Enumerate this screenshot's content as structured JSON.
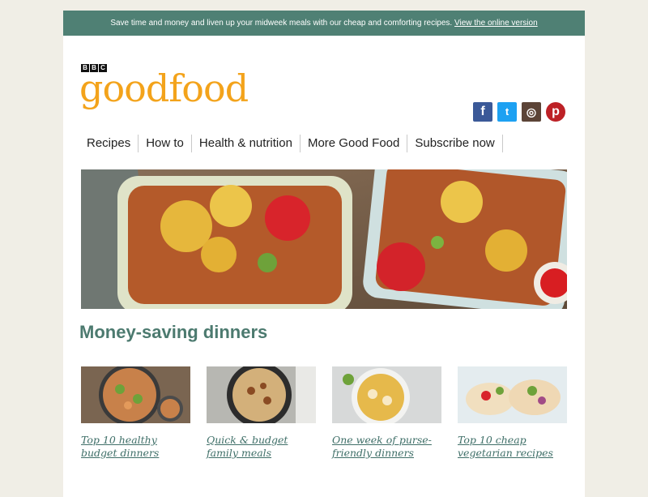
{
  "banner": {
    "text": "Save time and money and liven up your midweek meals with our cheap and comforting recipes.",
    "link": "View the online version"
  },
  "logo": {
    "bbc_letters": [
      "B",
      "B",
      "C"
    ],
    "wordmark": "goodfood"
  },
  "social": [
    {
      "name": "facebook-icon",
      "glyph": "f"
    },
    {
      "name": "twitter-icon",
      "glyph": "t"
    },
    {
      "name": "instagram-icon",
      "glyph": "◎"
    },
    {
      "name": "pinterest-icon",
      "glyph": "p"
    }
  ],
  "nav": [
    "Recipes",
    "How to",
    "Health & nutrition",
    "More Good Food",
    "Subscribe now"
  ],
  "section_title": "Money-saving dinners",
  "cards": [
    {
      "label": "Top 10 healthy budget dinners"
    },
    {
      "label": "Quick & budget family meals"
    },
    {
      "label": "One week of purse-friendly dinners"
    },
    {
      "label": "Top 10 cheap vegetarian recipes"
    }
  ],
  "colors": {
    "banner_bg": "#4f8074",
    "logo_orange": "#f3a31b",
    "title_teal": "#4c7a6f",
    "link_teal": "#3f6f68"
  }
}
